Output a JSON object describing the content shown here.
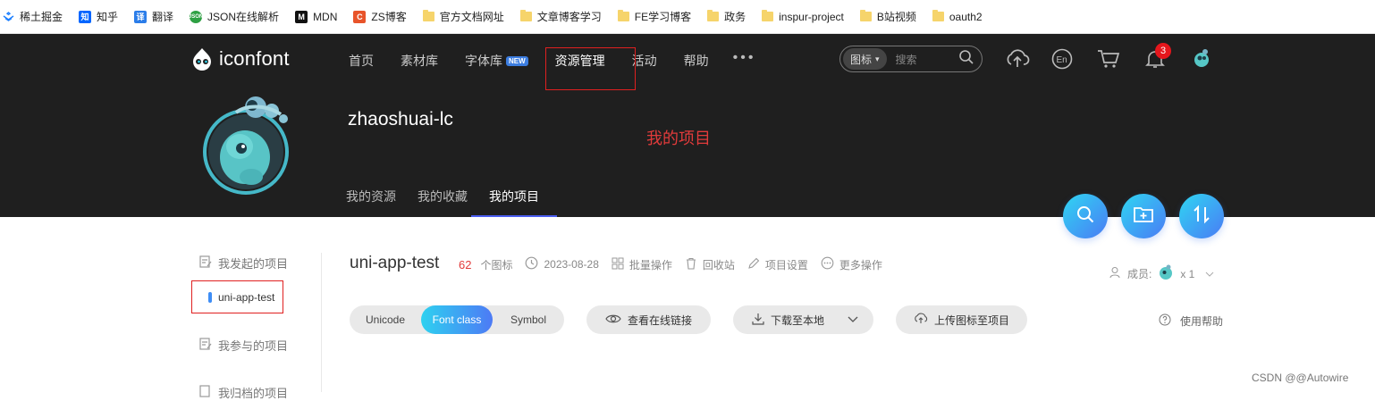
{
  "bookmarks": [
    {
      "label": "稀土掘金",
      "icon": "juejin-icon"
    },
    {
      "label": "知乎",
      "icon": "zhihu-icon",
      "glyph": "知"
    },
    {
      "label": "翻译",
      "icon": "translate-icon",
      "glyph": "译"
    },
    {
      "label": "JSON在线解析",
      "icon": "json-icon",
      "glyph": "JSON"
    },
    {
      "label": "MDN",
      "icon": "mdn-icon",
      "glyph": "M"
    },
    {
      "label": "ZS博客",
      "icon": "zs-blog-icon",
      "glyph": "C"
    },
    {
      "label": "官方文档网址",
      "icon": "folder-icon"
    },
    {
      "label": "文章博客学习",
      "icon": "folder-icon"
    },
    {
      "label": "FE学习博客",
      "icon": "folder-icon"
    },
    {
      "label": "政务",
      "icon": "folder-icon"
    },
    {
      "label": "inspur-project",
      "icon": "folder-icon"
    },
    {
      "label": "B站视频",
      "icon": "folder-icon"
    },
    {
      "label": "oauth2",
      "icon": "folder-icon"
    }
  ],
  "header": {
    "logo_text": "iconfont",
    "nav": [
      {
        "label": "首页"
      },
      {
        "label": "素材库"
      },
      {
        "label": "字体库",
        "badge": "NEW"
      },
      {
        "label": "资源管理",
        "active": true
      },
      {
        "label": "活动"
      },
      {
        "label": "帮助"
      }
    ],
    "more_label": "•••",
    "search": {
      "type_label": "图标",
      "placeholder": "搜索"
    },
    "notification_count": "3",
    "annotation": "我的项目",
    "username": "zhaoshuai-lc",
    "subtabs": [
      {
        "label": "我的资源"
      },
      {
        "label": "我的收藏"
      },
      {
        "label": "我的项目",
        "active": true
      }
    ]
  },
  "sidebar": {
    "started_label": "我发起的项目",
    "project_label": "uni-app-test",
    "joined_label": "我参与的项目",
    "archived_label": "我归档的项目"
  },
  "project": {
    "title": "uni-app-test",
    "icon_count": "62",
    "icon_count_unit": "个图标",
    "date": "2023-08-28",
    "batch_label": "批量操作",
    "recycle_label": "回收站",
    "settings_label": "项目设置",
    "more_label": "更多操作",
    "members_label": "成员:",
    "members_count": "x 1"
  },
  "toolbar": {
    "formats": [
      {
        "label": "Unicode"
      },
      {
        "label": "Font class",
        "active": true
      },
      {
        "label": "Symbol"
      }
    ],
    "online_link_label": "查看在线链接",
    "download_label": "下载至本地",
    "upload_label": "上传图标至项目",
    "help_label": "使用帮助"
  },
  "watermark": "CSDN @@Autowire",
  "colors": {
    "header_bg": "#1f1f1f",
    "accent_gradient_start": "#2fd6f2",
    "accent_gradient_end": "#4a7bf5",
    "annotation_red": "#e02020",
    "count_red": "#e23b3b"
  }
}
